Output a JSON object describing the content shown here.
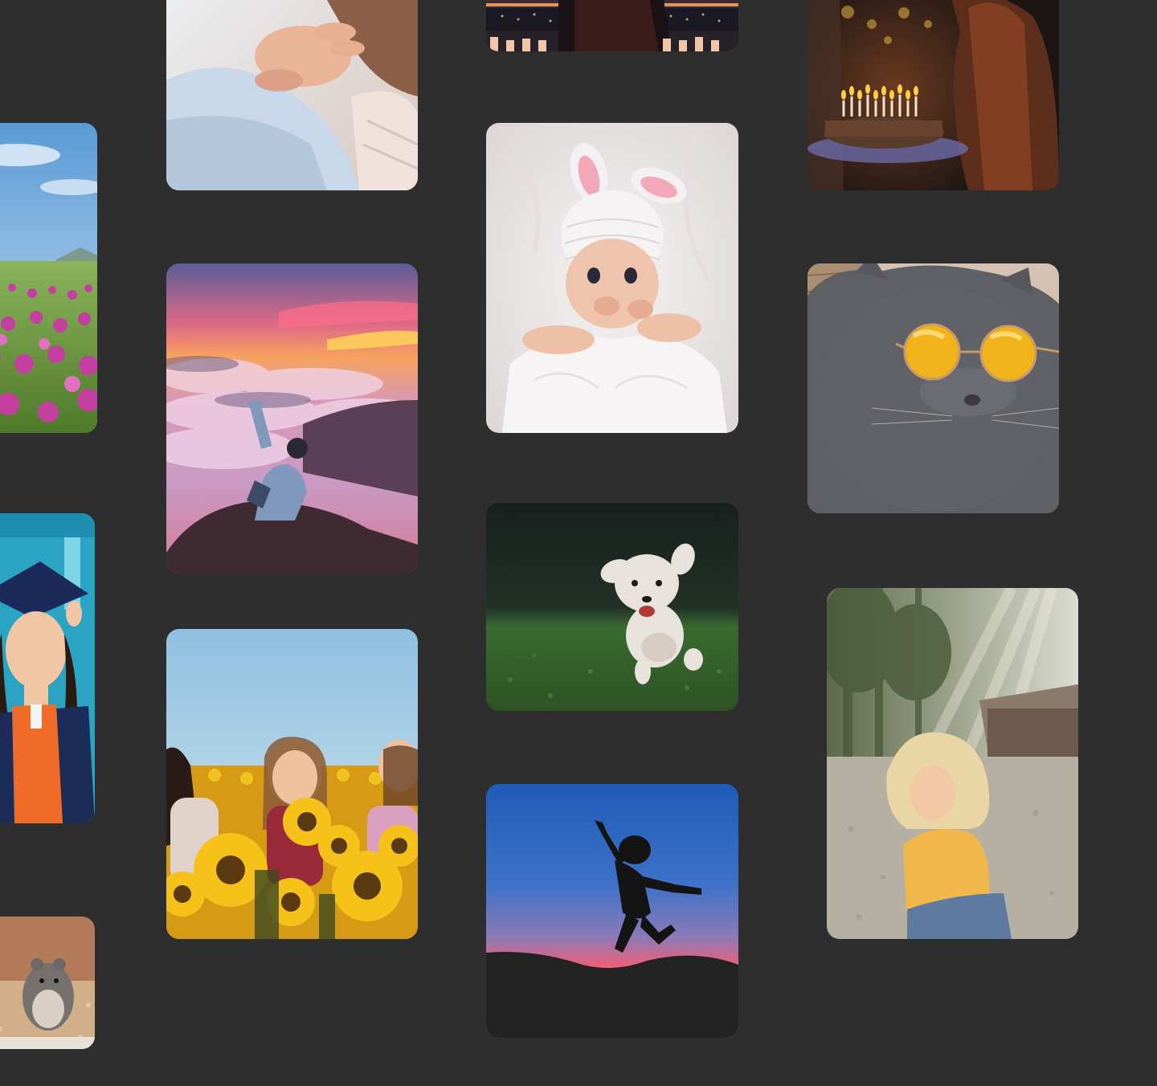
{
  "gallery": {
    "photos": [
      {
        "subject": "flower-field",
        "palette": [
          "#7cb3e0",
          "#c84aa8",
          "#6c9a3e"
        ]
      },
      {
        "subject": "graduate",
        "palette": [
          "#2ba7c4",
          "#f06b28",
          "#1c2c58"
        ]
      },
      {
        "subject": "hamster",
        "palette": [
          "#9a6b4e",
          "#d8b48a",
          "#6e6a66"
        ]
      },
      {
        "subject": "baby-hand",
        "palette": [
          "#c9d8e8",
          "#e4b394",
          "#f0e4dc"
        ]
      },
      {
        "subject": "mountain-sunset",
        "palette": [
          "#f46f7a",
          "#c08ab8",
          "#3f2a36"
        ]
      },
      {
        "subject": "sunflower-friends",
        "palette": [
          "#a9cfe6",
          "#f2bf18",
          "#3c4a20"
        ]
      },
      {
        "subject": "city-night",
        "palette": [
          "#1b1a22",
          "#e78c56",
          "#f4c9a8"
        ]
      },
      {
        "subject": "baby-bunny-hat",
        "palette": [
          "#ece7e7",
          "#f3a7b9",
          "#e9c1a8"
        ]
      },
      {
        "subject": "running-dog",
        "palette": [
          "#1d2a24",
          "#3c6a34",
          "#e6e0dc"
        ]
      },
      {
        "subject": "jump-silhouette",
        "palette": [
          "#2e67c4",
          "#f0607a",
          "#151515"
        ]
      },
      {
        "subject": "birthday-cake",
        "palette": [
          "#231b1a",
          "#f4b33c",
          "#6a3c2c"
        ]
      },
      {
        "subject": "cat-sunglasses",
        "palette": [
          "#5e6066",
          "#f6b81a",
          "#c9b2a0"
        ]
      },
      {
        "subject": "girl-sunlight",
        "palette": [
          "#b8b6a8",
          "#f2c45a",
          "#5d6a4a"
        ]
      }
    ]
  }
}
